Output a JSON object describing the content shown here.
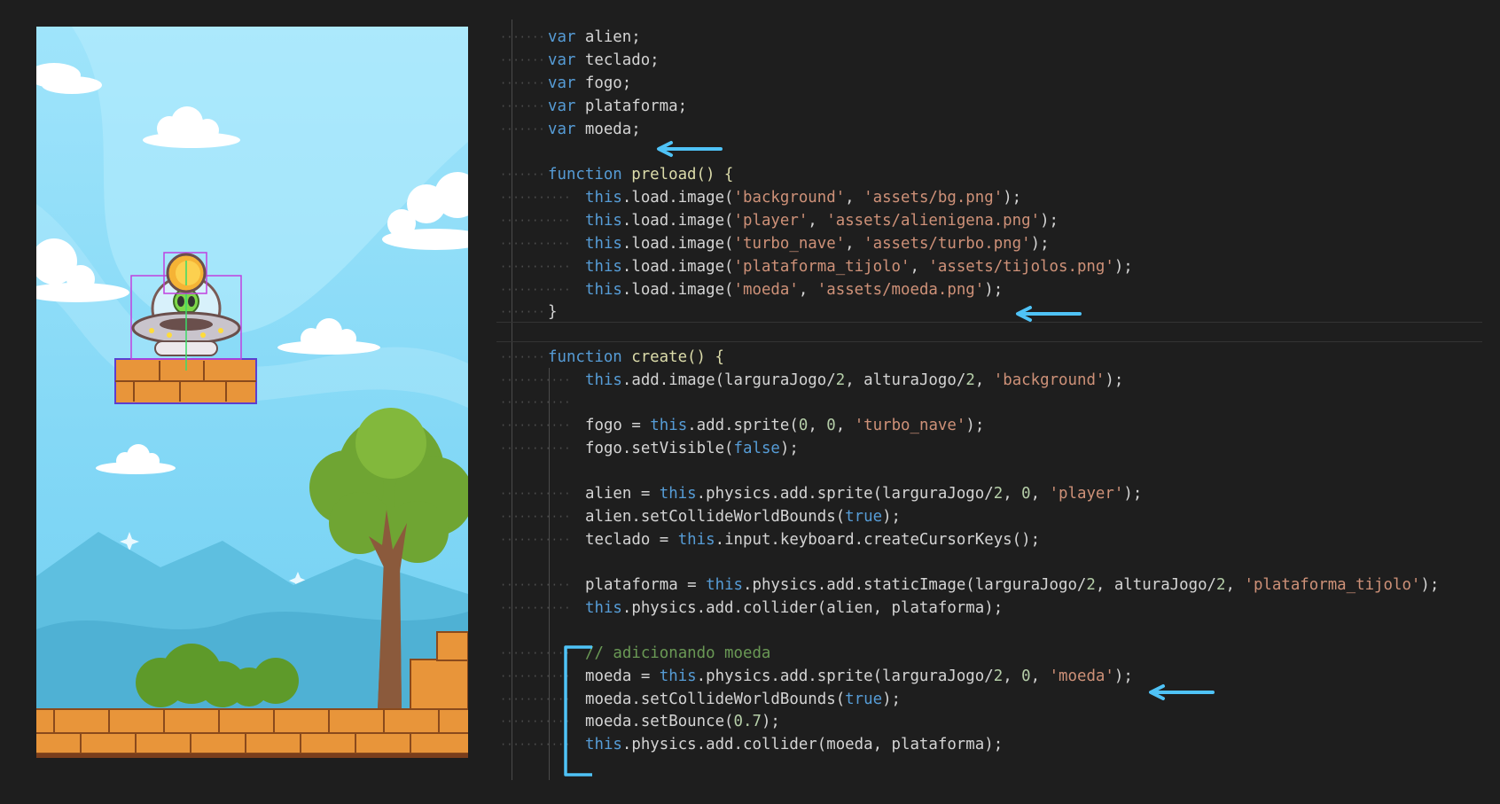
{
  "colors": {
    "editor_bg": "#1e1e1e",
    "keyword": "#569cd6",
    "string": "#ce9178",
    "number": "#b5cea8",
    "comment": "#6a9955",
    "text": "#d4d4d4",
    "annotation": "#4fc3f7",
    "sky": "#7fd6f5",
    "brick": "#e8953a"
  },
  "game": {
    "sprites": [
      "alien-ufo",
      "coin",
      "brick-platform",
      "tree",
      "bushes",
      "brick-ground",
      "clouds",
      "mountains"
    ]
  },
  "code": {
    "decl": [
      {
        "kw": "var",
        "name": " alien;"
      },
      {
        "kw": "var",
        "name": " teclado;"
      },
      {
        "kw": "var",
        "name": " fogo;"
      },
      {
        "kw": "var",
        "name": " plataforma;"
      },
      {
        "kw": "var",
        "name": " moeda;"
      }
    ],
    "preload": {
      "kw": "function",
      "sig": " preload() {",
      "lines": [
        {
          "this": "this",
          "call": ".load.image(",
          "a1": "'background'",
          "c": ", ",
          "a2": "'assets/bg.png'",
          "end": ");"
        },
        {
          "this": "this",
          "call": ".load.image(",
          "a1": "'player'",
          "c": ", ",
          "a2": "'assets/alienigena.png'",
          "end": ");"
        },
        {
          "this": "this",
          "call": ".load.image(",
          "a1": "'turbo_nave'",
          "c": ", ",
          "a2": "'assets/turbo.png'",
          "end": ");"
        },
        {
          "this": "this",
          "call": ".load.image(",
          "a1": "'plataforma_tijolo'",
          "c": ", ",
          "a2": "'assets/tijolos.png'",
          "end": ");"
        },
        {
          "this": "this",
          "call": ".load.image(",
          "a1": "'moeda'",
          "c": ", ",
          "a2": "'assets/moeda.png'",
          "end": ");"
        }
      ],
      "close": "}"
    },
    "create": {
      "kw": "function",
      "sig": " create() {",
      "l1": {
        "this": "this",
        "rest": ".add.image(larguraJogo/",
        "n1": "2",
        "mid": ", alturaJogo/",
        "n2": "2",
        "c": ", ",
        "s": "'background'",
        "end": ");"
      },
      "l2": {
        "pre": "fogo = ",
        "this": "this",
        "rest": ".add.sprite(",
        "n1": "0",
        "c1": ", ",
        "n2": "0",
        "c2": ", ",
        "s": "'turbo_nave'",
        "end": ");"
      },
      "l3": {
        "pre": "fogo.setVisible(",
        "kw": "false",
        "end": ");"
      },
      "l4": {
        "pre": "alien = ",
        "this": "this",
        "rest": ".physics.add.sprite(larguraJogo/",
        "n1": "2",
        "c1": ", ",
        "n2": "0",
        "c2": ", ",
        "s": "'player'",
        "end": ");"
      },
      "l5": {
        "pre": "alien.setCollideWorldBounds(",
        "kw": "true",
        "end": ");"
      },
      "l6": {
        "pre": "teclado = ",
        "this": "this",
        "rest": ".input.keyboard.createCursorKeys();"
      },
      "l7": {
        "pre": "plataforma = ",
        "this": "this",
        "rest": ".physics.add.staticImage(larguraJogo/",
        "n1": "2",
        "mid": ", alturaJogo/",
        "n2": "2",
        "c": ", ",
        "s": "'plataforma_tijolo'",
        "end": ");"
      },
      "l8": {
        "this": "this",
        "rest": ".physics.add.collider(alien, plataforma);"
      },
      "comment": "// adicionando moeda",
      "l9": {
        "pre": "moeda = ",
        "this": "this",
        "rest": ".physics.add.sprite(larguraJogo/",
        "n1": "2",
        "c1": ", ",
        "n2": "0",
        "c2": ", ",
        "s": "'moeda'",
        "end": ");"
      },
      "l10": {
        "pre": "moeda.setCollideWorldBounds(",
        "kw": "true",
        "end": ");"
      },
      "l11": {
        "pre": "moeda.setBounce(",
        "n": "0.7",
        "end": ");"
      },
      "l12": {
        "this": "this",
        "rest": ".physics.add.collider(moeda, plataforma);"
      }
    }
  }
}
